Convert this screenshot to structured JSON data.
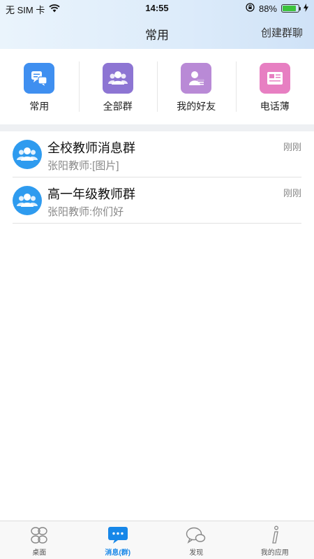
{
  "status_bar": {
    "carrier": "无 SIM 卡",
    "time": "14:55",
    "battery": "88%",
    "battery_level": 0.88
  },
  "header": {
    "title": "常用",
    "create_group": "创建群聊"
  },
  "quick_actions": [
    {
      "label": "常用",
      "icon": "chat-bubbles-icon",
      "color": "#3f8ff0"
    },
    {
      "label": "全部群",
      "icon": "group-icon",
      "color": "#8d75d3"
    },
    {
      "label": "我的好友",
      "icon": "contact-card-icon",
      "color": "#b98ad6"
    },
    {
      "label": "电话薄",
      "icon": "phonebook-icon",
      "color": "#e77fc2"
    }
  ],
  "groups": [
    {
      "name": "全校教师消息群",
      "last_message": "张阳教师:[图片]",
      "time": "刚刚"
    },
    {
      "name": "高一年级教师群",
      "last_message": "张阳教师:你们好",
      "time": "刚刚"
    }
  ],
  "tabs": [
    {
      "label": "桌面",
      "icon": "desktop-grid-icon"
    },
    {
      "label": "消息(群)",
      "icon": "message-icon",
      "active": true
    },
    {
      "label": "发现",
      "icon": "discover-chat-icon"
    },
    {
      "label": "我的应用",
      "icon": "info-icon"
    }
  ],
  "colors": {
    "accent": "#1787e8",
    "avatar": "#2e9bef"
  }
}
